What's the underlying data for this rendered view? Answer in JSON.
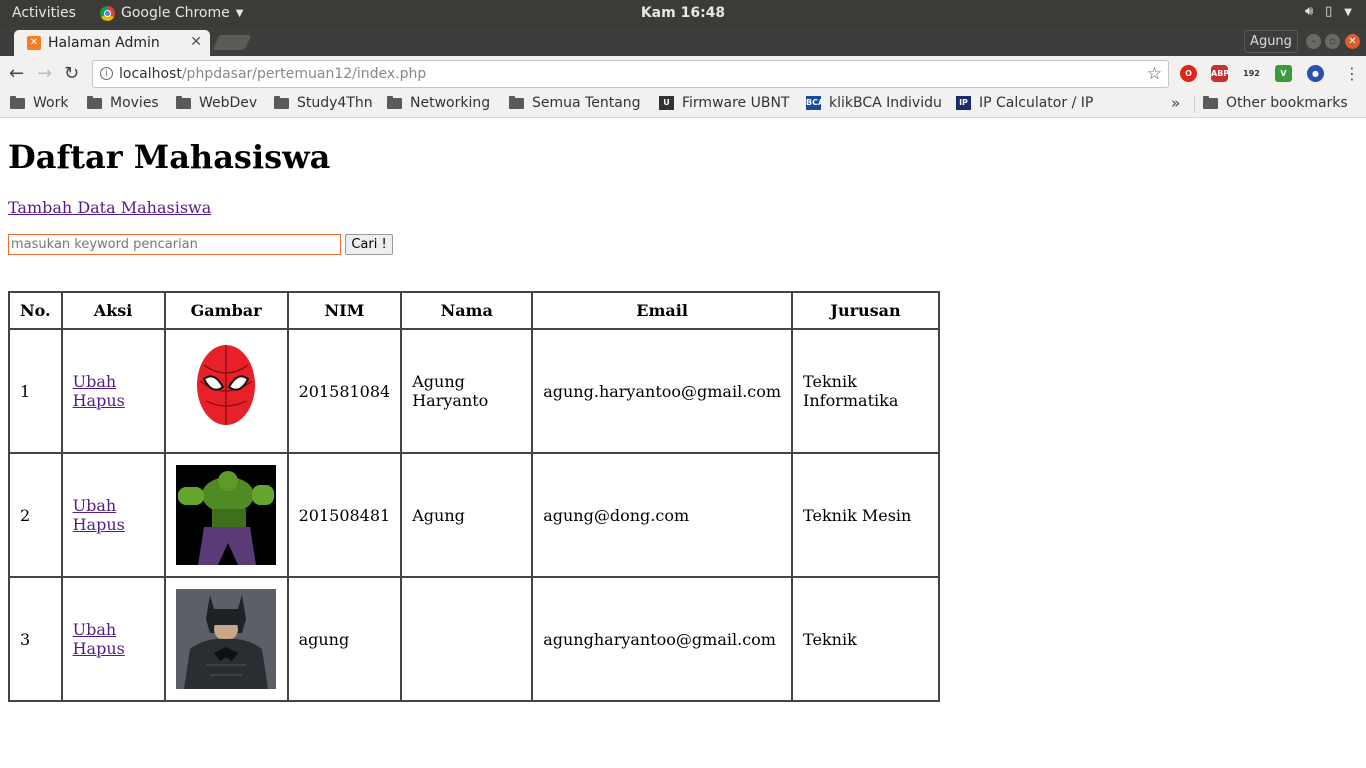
{
  "system": {
    "activities": "Activities",
    "app_name": "Google Chrome",
    "clock": "Kam 16:48"
  },
  "browser": {
    "tab_title": "Halaman Admin",
    "profile": "Agung",
    "url_host": "localhost",
    "url_path": "/phpdasar/pertemuan12/index.php",
    "bookmarks": [
      "Work",
      "Movies",
      "WebDev",
      "Study4Thn",
      "Networking",
      "Semua Tentang",
      "Firmware UBNT",
      "klikBCA Individu",
      "IP Calculator / IP",
      "Other bookmarks"
    ],
    "chevron": "»"
  },
  "page": {
    "heading": "Daftar Mahasiswa",
    "add_link": "Tambah Data Mahasiswa",
    "search_placeholder": "masukan keyword pencarian",
    "search_button": "Cari !",
    "headers": [
      "No.",
      "Aksi",
      "Gambar",
      "NIM",
      "Nama",
      "Email",
      "Jurusan"
    ],
    "edit_label": "Ubah",
    "delete_label": "Hapus",
    "rows": [
      {
        "no": "1",
        "nim": "201581084",
        "nama": "Agung Haryanto",
        "email": "agung.haryantoo@gmail.com",
        "jurusan": "Teknik Informatika",
        "image": "spiderman-mask"
      },
      {
        "no": "2",
        "nim": "201508481",
        "nama": "Agung",
        "email": "agung@dong.com",
        "jurusan": "Teknik Mesin",
        "image": "hulk"
      },
      {
        "no": "3",
        "nim": "agung",
        "nama": "",
        "email": "agungharyantoo@gmail.com",
        "jurusan": "Teknik",
        "image": "batman"
      }
    ]
  }
}
